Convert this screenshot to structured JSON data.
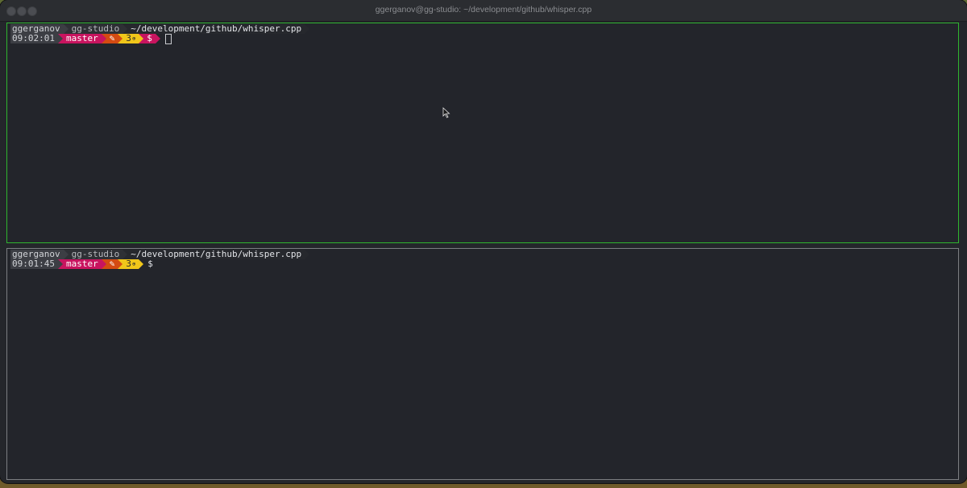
{
  "window": {
    "title": "ggerganov@gg-studio: ~/development/github/whisper.cpp"
  },
  "panes": {
    "top": {
      "user": "ggerganov",
      "host": "gg-studio",
      "path": "~/development/github/whisper.cpp",
      "time": "09:02:01",
      "branch": "master",
      "edit_icon": "✎",
      "count": "3",
      "count_icon": "⊕",
      "prompt": "$"
    },
    "bottom": {
      "user": "ggerganov",
      "host": "gg-studio",
      "path": "~/development/github/whisper.cpp",
      "time": "09:01:45",
      "branch": "master",
      "edit_icon": "✎",
      "count": "3",
      "count_icon": "⊕",
      "prompt": "$"
    }
  },
  "colors": {
    "active_pane_border": "#2fb52f",
    "inactive_pane_border": "#7c7e82",
    "branch_segment": "#c8145f",
    "edit_segment": "#d44b12",
    "count_segment": "#f0c61a"
  }
}
